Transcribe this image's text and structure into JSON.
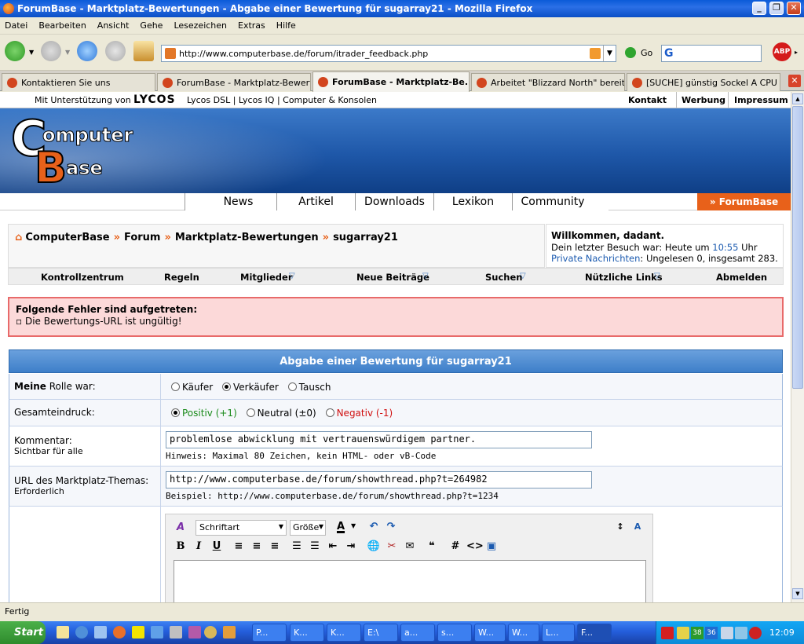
{
  "window": {
    "title": "ForumBase - Marktplatz-Bewertungen - Abgabe einer Bewertung für sugarray21 - Mozilla Firefox"
  },
  "menu": [
    "Datei",
    "Bearbeiten",
    "Ansicht",
    "Gehe",
    "Lesezeichen",
    "Extras",
    "Hilfe"
  ],
  "address": {
    "url": "http://www.computerbase.de/forum/itrader_feedback.php",
    "go_label": "Go",
    "adblock_label": "ABP"
  },
  "tabs": [
    {
      "label": "Kontaktieren Sie uns"
    },
    {
      "label": "ForumBase - Marktplatz-Bewert..."
    },
    {
      "label": "ForumBase - Marktplatz-Be..."
    },
    {
      "label": "Arbeitet \"Blizzard North\" bereits..."
    },
    {
      "label": "[SUCHE] günstig Sockel A CPU !..."
    }
  ],
  "lycos": {
    "support_text": "Mit Unterstützung von",
    "logo": "LYCOS",
    "links": "Lycos DSL | Lycos IQ | Computer & Konsolen",
    "right_links": [
      "Kontakt",
      "Werbung",
      "Impressum"
    ]
  },
  "logo": {
    "line1": "omputer",
    "line2": "ase",
    "c": "C",
    "b": "B"
  },
  "mainnav": {
    "items": [
      "News",
      "Artikel",
      "Downloads",
      "Lexikon",
      "Community"
    ],
    "forumbase": "» ForumBase"
  },
  "breadcrumb": {
    "home": "ComputerBase",
    "sep": "»",
    "forum": "Forum",
    "section": "Marktplatz-Bewertungen",
    "user": "sugarray21"
  },
  "welcome": {
    "title": "Willkommen, dadant.",
    "last_visit_prefix": "Dein letzter Besuch war: Heute um",
    "last_visit_time": "10:55",
    "last_visit_suffix": "Uhr",
    "pm_link": "Private Nachrichten",
    "pm_text": ": Ungelesen 0, insgesamt 283."
  },
  "subnav": [
    "Kontrollzentrum",
    "Regeln",
    "Mitglieder",
    "Neue Beiträge",
    "Suchen",
    "Nützliche Links",
    "Abmelden"
  ],
  "error": {
    "title": "Folgende Fehler sind aufgetreten:",
    "message": "Die Bewertungs-URL ist ungültig!"
  },
  "form": {
    "header": "Abgabe einer Bewertung für sugarray21",
    "role": {
      "label_bold": "Meine",
      "label_rest": "Rolle war:",
      "options": [
        "Käufer",
        "Verkäufer",
        "Tausch"
      ]
    },
    "rating": {
      "label": "Gesamteindruck:",
      "positive": "Positiv (+1)",
      "neutral": "Neutral (±0)",
      "negative": "Negativ (-1)",
      "colors": {
        "positive": "#1a8a1a",
        "negative": "#d01010"
      }
    },
    "comment": {
      "label": "Kommentar:",
      "sub": "Sichtbar für alle",
      "value": "problemlose abwicklung mit vertrauenswürdigem partner.",
      "hint": "Hinweis: Maximal 80 Zeichen, kein HTML- oder vB-Code"
    },
    "url": {
      "label": "URL des Marktplatz-Themas:",
      "sub": "Erforderlich",
      "value": "http://www.computerbase.de/forum/showthread.php?t=264982",
      "hint": "Beispiel: http://www.computerbase.de/forum/showthread.php?t=1234"
    },
    "editor": {
      "font": "Schriftart",
      "size": "Größe"
    }
  },
  "status": {
    "text": "Fertig"
  },
  "taskbar": {
    "start": "Start",
    "tasks": [
      "P...",
      "K...",
      "K...",
      "E:\\",
      "a...",
      "s...",
      "W...",
      "W...",
      "L...",
      "F..."
    ],
    "clock": "12:09",
    "tray_nums": [
      "38",
      "36"
    ]
  }
}
